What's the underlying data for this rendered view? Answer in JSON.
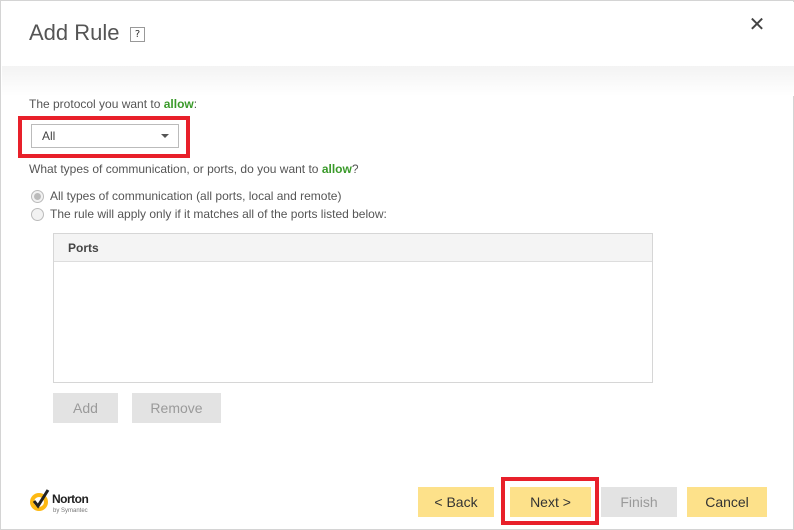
{
  "dialog": {
    "title": "Add Rule",
    "help_label": "?",
    "close_icon": "close-icon"
  },
  "protocol": {
    "label_prefix": "The protocol you want to ",
    "label_emph": "allow",
    "label_suffix": ":",
    "selected": "All"
  },
  "ports_question": {
    "prefix": "What types of communication, or ports, do you want to ",
    "emph": "allow",
    "suffix": "?"
  },
  "options": [
    {
      "label": "All types of communication (all ports, local and remote)",
      "selected": true
    },
    {
      "label": "The rule will apply only if it matches all of the ports listed below:",
      "selected": false
    }
  ],
  "ports_table": {
    "header": "Ports",
    "rows": []
  },
  "ports_buttons": {
    "add": "Add",
    "remove": "Remove"
  },
  "footer": {
    "back": "< Back",
    "next": "Next >",
    "finish": "Finish",
    "cancel": "Cancel"
  },
  "logo": {
    "brand": "Norton",
    "sub": "by Symantec"
  },
  "colors": {
    "accent_green": "#3a9a2a",
    "button_yellow": "#fde18a",
    "highlight_red": "#e8202a",
    "disabled_gray": "#e3e3e3"
  }
}
